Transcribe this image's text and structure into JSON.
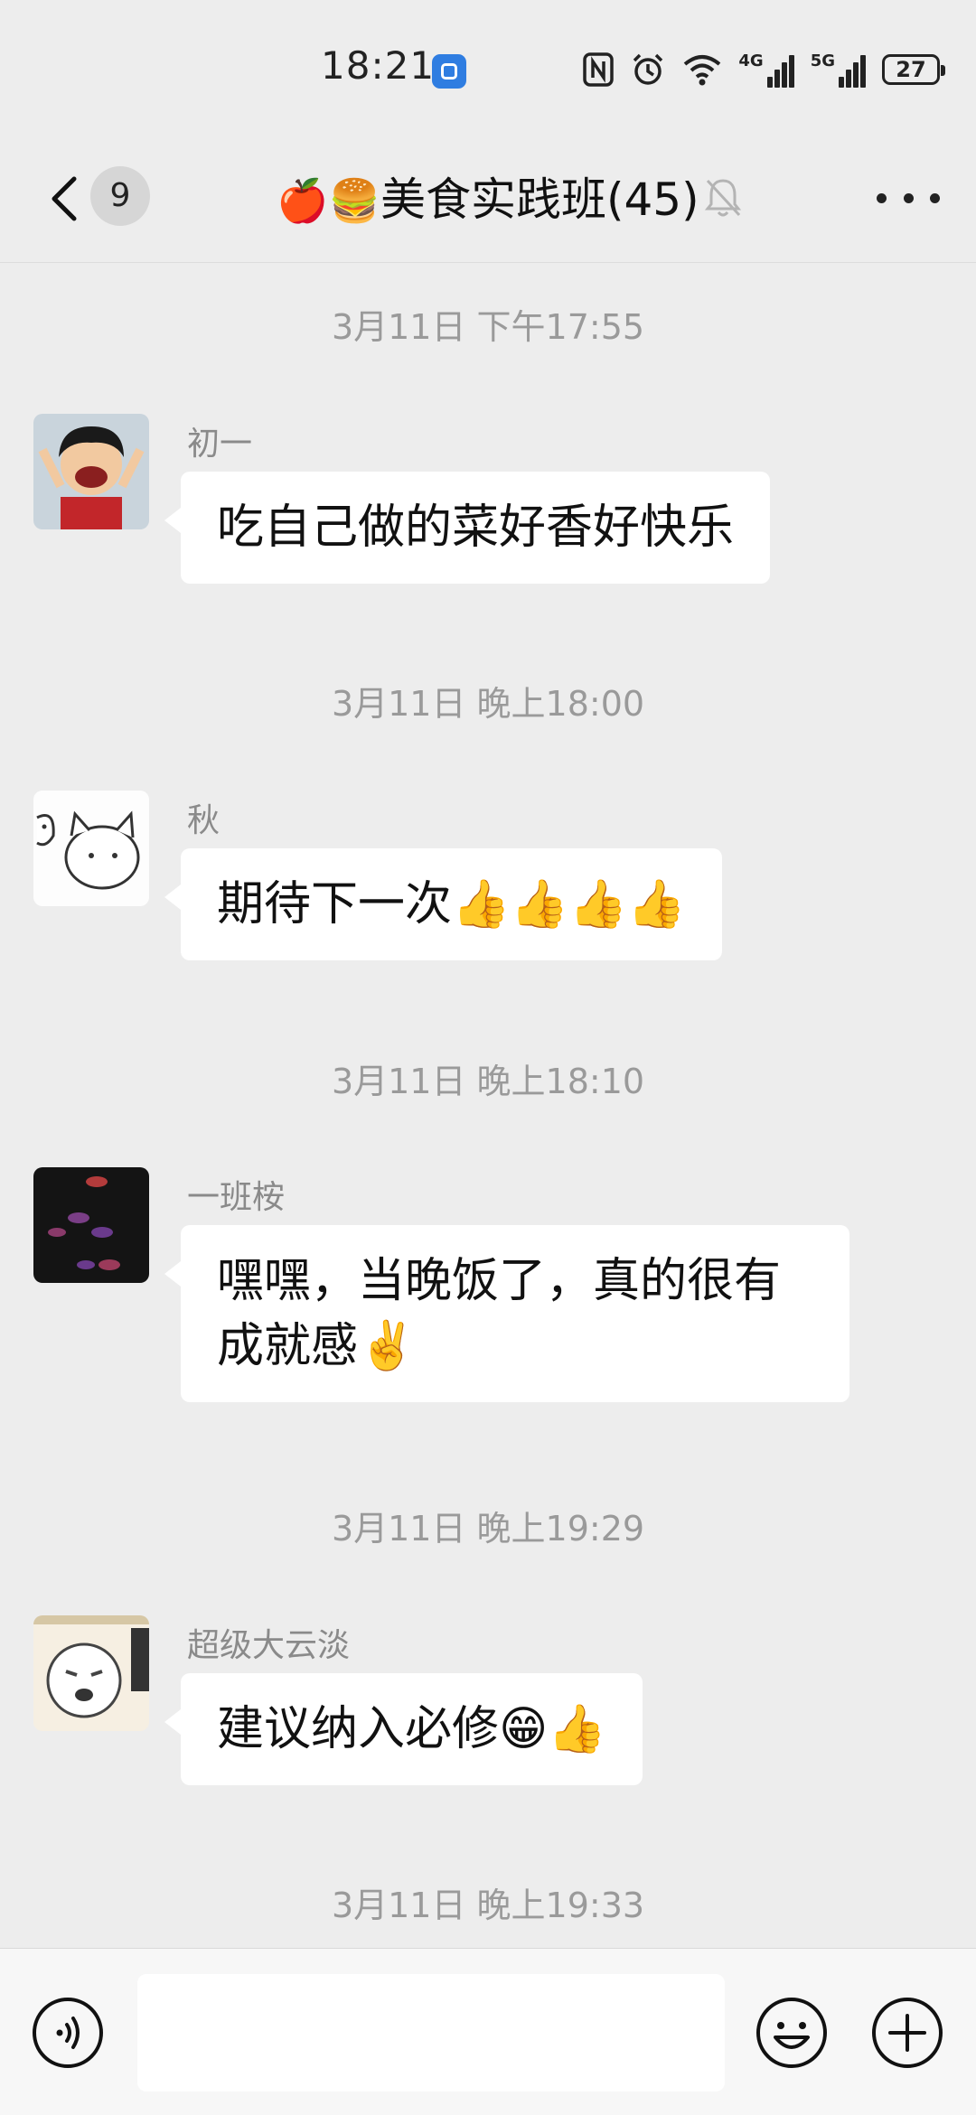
{
  "status_bar": {
    "time": "18:21",
    "nfc_icon": "nfc-icon",
    "alarm_icon": "alarm-icon",
    "wifi_icon": "wifi-icon",
    "network1": "4G",
    "network2": "5G",
    "battery": "27"
  },
  "nav": {
    "unread_count": "9",
    "title_emoji": "🍎🍔",
    "title": "美食实践班(45)",
    "muted": true
  },
  "messages": [
    {
      "timestamp": "3月11日 下午17:55",
      "sender": "初一",
      "text": "吃自己做的菜好香好快乐"
    },
    {
      "timestamp": "3月11日 晚上18:00",
      "sender": "秋",
      "text": "期待下一次👍👍👍👍"
    },
    {
      "timestamp": "3月11日 晚上18:10",
      "sender": "一班桉",
      "text": "嘿嘿，当晚饭了，真的很有成就感✌️"
    },
    {
      "timestamp": "3月11日 晚上19:29",
      "sender": "超级大云淡",
      "text": "建议纳入必修😁👍"
    }
  ],
  "last_timestamp": "3月11日 晚上19:33",
  "input": {
    "value": "",
    "placeholder": ""
  }
}
